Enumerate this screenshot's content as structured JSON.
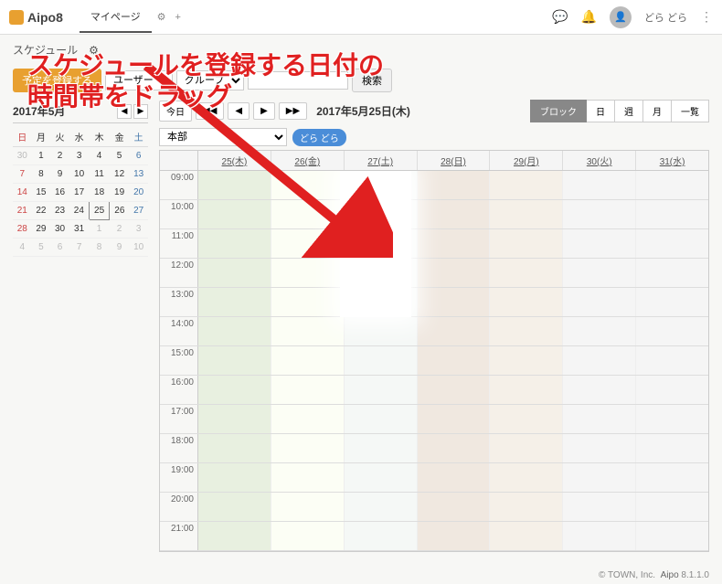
{
  "app_name": "Aipo8",
  "tab": "マイページ",
  "user": "どら どら",
  "schedule_title": "スケジュール",
  "toolbar": {
    "register": "予定を登録する",
    "user_opts": [
      "ユーザー"
    ],
    "group_opts": [
      "グループ"
    ],
    "search": "検索"
  },
  "mini_cal": {
    "title": "2017年5月",
    "dow": [
      "日",
      "月",
      "火",
      "水",
      "木",
      "金",
      "土"
    ],
    "rows": [
      [
        {
          "d": "30",
          "c": "other"
        },
        {
          "d": "1"
        },
        {
          "d": "2"
        },
        {
          "d": "3"
        },
        {
          "d": "4"
        },
        {
          "d": "5"
        },
        {
          "d": "6",
          "c": "sat"
        }
      ],
      [
        {
          "d": "7",
          "c": "sun"
        },
        {
          "d": "8"
        },
        {
          "d": "9"
        },
        {
          "d": "10"
        },
        {
          "d": "11"
        },
        {
          "d": "12"
        },
        {
          "d": "13",
          "c": "sat"
        }
      ],
      [
        {
          "d": "14",
          "c": "sun"
        },
        {
          "d": "15"
        },
        {
          "d": "16"
        },
        {
          "d": "17"
        },
        {
          "d": "18"
        },
        {
          "d": "19"
        },
        {
          "d": "20",
          "c": "sat"
        }
      ],
      [
        {
          "d": "21",
          "c": "sun"
        },
        {
          "d": "22"
        },
        {
          "d": "23"
        },
        {
          "d": "24"
        },
        {
          "d": "25",
          "c": "today"
        },
        {
          "d": "26"
        },
        {
          "d": "27",
          "c": "sat"
        }
      ],
      [
        {
          "d": "28",
          "c": "sun"
        },
        {
          "d": "29"
        },
        {
          "d": "30"
        },
        {
          "d": "31"
        },
        {
          "d": "1",
          "c": "other"
        },
        {
          "d": "2",
          "c": "other"
        },
        {
          "d": "3",
          "c": "other"
        }
      ],
      [
        {
          "d": "4",
          "c": "other"
        },
        {
          "d": "5",
          "c": "other"
        },
        {
          "d": "6",
          "c": "other"
        },
        {
          "d": "7",
          "c": "other"
        },
        {
          "d": "8",
          "c": "other"
        },
        {
          "d": "9",
          "c": "other"
        },
        {
          "d": "10",
          "c": "other"
        }
      ]
    ]
  },
  "nav": {
    "today": "今日",
    "date": "2017年5月25日(木)",
    "views": [
      "ブロック",
      "日",
      "週",
      "月",
      "一覧"
    ]
  },
  "dept": "本部",
  "user_tag": "どら どら",
  "day_headers": [
    "25(木)",
    "26(金)",
    "27(土)",
    "28(日)",
    "29(月)",
    "30(火)",
    "31(水)"
  ],
  "hours": [
    "09:00",
    "10:00",
    "11:00",
    "12:00",
    "13:00",
    "14:00",
    "15:00",
    "16:00",
    "17:00",
    "18:00",
    "19:00",
    "20:00",
    "21:00"
  ],
  "footer": {
    "copy": "© TOWN, Inc.",
    "link": "Aipo",
    "ver": "8.1.1.0"
  },
  "annotation": "スケジュールを登録する日付の\n時間帯をドラッグ"
}
